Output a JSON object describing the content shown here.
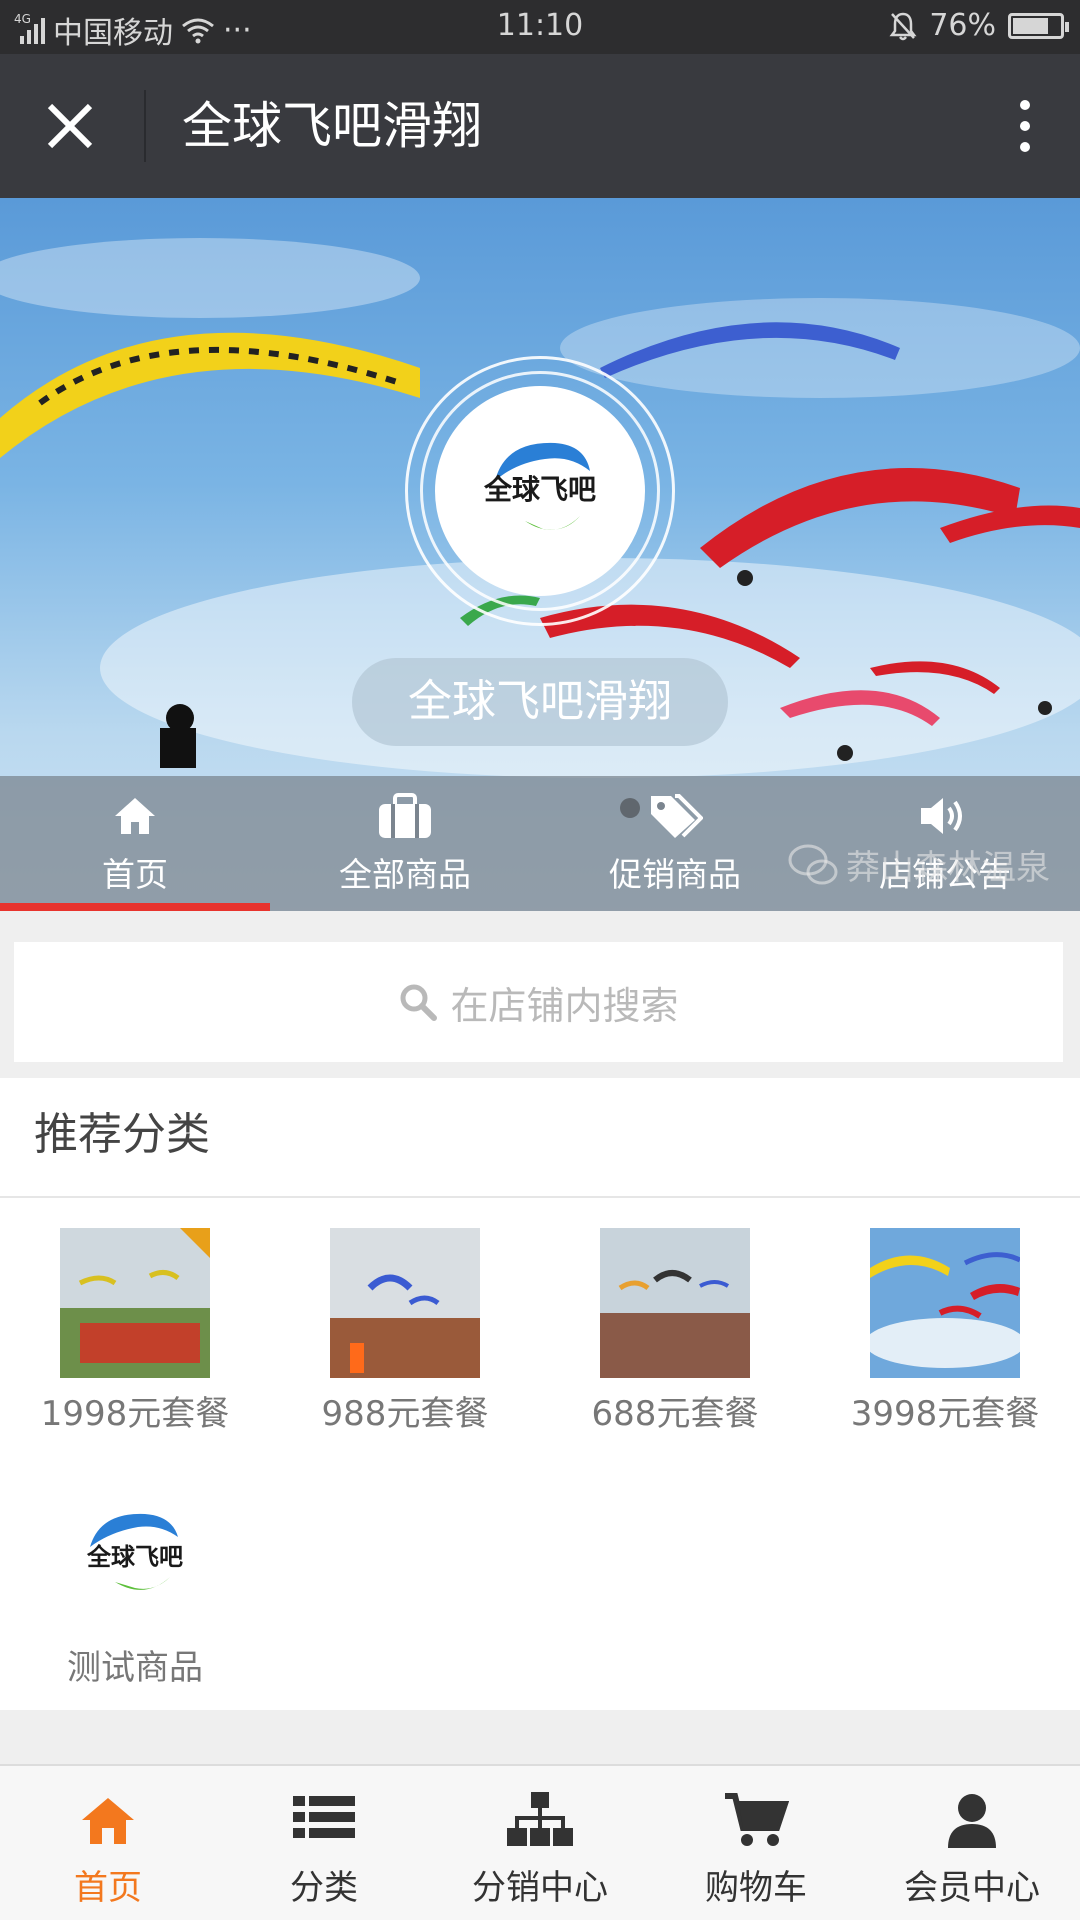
{
  "status_bar": {
    "network": "4G",
    "carrier": "中国移动",
    "dots": "···",
    "time": "11:10",
    "battery": "76%",
    "battery_level": 0.76
  },
  "nav": {
    "title": "全球飞吧滑翔"
  },
  "banner": {
    "logo_text": "全球飞吧",
    "shop_name": "全球飞吧滑翔",
    "tabs": [
      {
        "label": "首页",
        "icon": "home-icon",
        "active": true
      },
      {
        "label": "全部商品",
        "icon": "briefcase-icon",
        "active": false
      },
      {
        "label": "促销商品",
        "icon": "tags-icon",
        "active": false
      },
      {
        "label": "店铺公告",
        "icon": "speaker-icon",
        "active": false
      }
    ],
    "watermark": "莽山森林温泉",
    "accent": "#e8332d"
  },
  "search": {
    "placeholder": "在店铺内搜索"
  },
  "recommend": {
    "title": "推荐分类",
    "items": [
      {
        "label": "1998元套餐"
      },
      {
        "label": "988元套餐"
      },
      {
        "label": "688元套餐"
      },
      {
        "label": "3998元套餐"
      },
      {
        "label": "测试商品",
        "logo_text": "全球飞吧"
      }
    ]
  },
  "tabbar": {
    "items": [
      {
        "label": "首页",
        "icon": "home-icon",
        "active": true
      },
      {
        "label": "分类",
        "icon": "list-icon",
        "active": false
      },
      {
        "label": "分销中心",
        "icon": "sitemap-icon",
        "active": false
      },
      {
        "label": "购物车",
        "icon": "cart-icon",
        "active": false
      },
      {
        "label": "会员中心",
        "icon": "user-icon",
        "active": false
      }
    ],
    "active_color": "#f3781e"
  }
}
